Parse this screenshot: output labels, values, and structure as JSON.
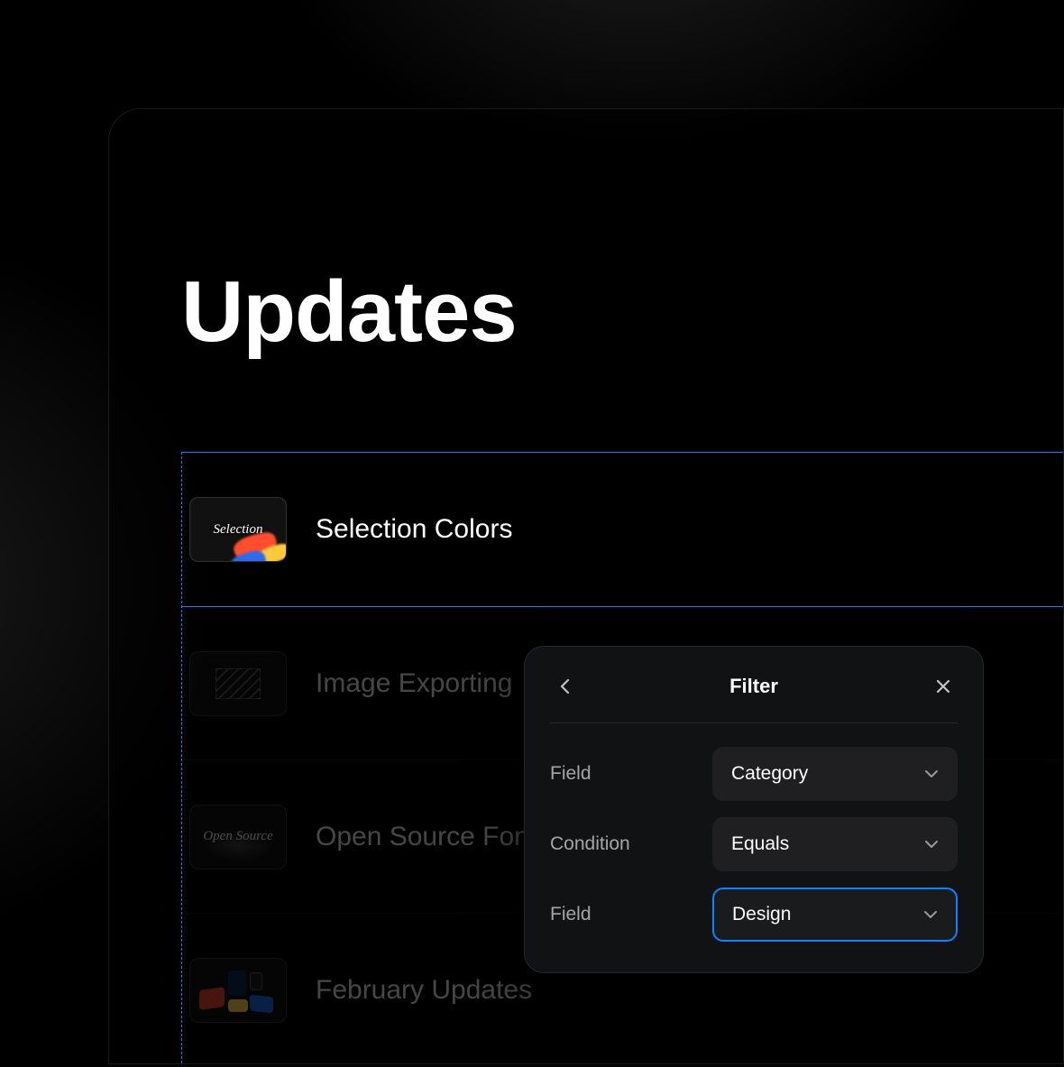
{
  "page": {
    "title": "Updates"
  },
  "list": {
    "items": [
      {
        "title": "Selection Colors",
        "thumb_label": "Selection",
        "selected": true
      },
      {
        "title": "Image Exporting",
        "selected": false
      },
      {
        "title": "Open Source Fonts",
        "thumb_label": "Open Source",
        "selected": false
      },
      {
        "title": "February Updates",
        "selected": false
      }
    ]
  },
  "filter": {
    "title": "Filter",
    "rows": [
      {
        "label": "Field",
        "value": "Category",
        "focused": false
      },
      {
        "label": "Condition",
        "value": "Equals",
        "focused": false
      },
      {
        "label": "Field",
        "value": "Design",
        "focused": true
      }
    ]
  },
  "colors": {
    "accent": "#0a84ff"
  }
}
